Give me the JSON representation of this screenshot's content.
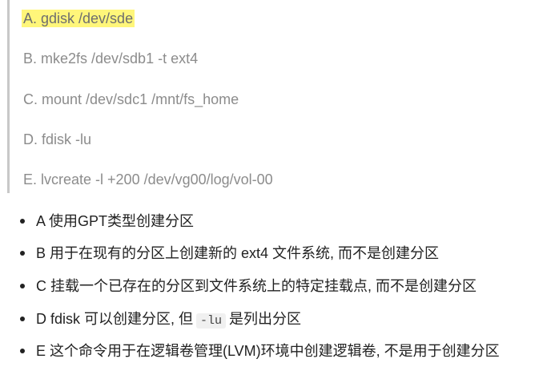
{
  "options": {
    "a": "A. gdisk /dev/sde",
    "b": "B. mke2fs /dev/sdb1 -t ext4",
    "c": "C. mount /dev/sdc1 /mnt/fs_home",
    "d": "D. fdisk -lu",
    "e": "E. lvcreate -l +200 /dev/vg00/log/vol-00"
  },
  "highlight_color": "#fff67a",
  "explanations": {
    "a": "A 使用GPT类型创建分区",
    "b": "B 用于在现有的分区上创建新的 ext4 文件系统, 而不是创建分区",
    "c": "C 挂载一个已存在的分区到文件系统上的特定挂载点, 而不是创建分区",
    "d_before": "D fdisk 可以创建分区, 但",
    "d_code": "-lu",
    "d_after": "是列出分区",
    "e": "E 这个命令用于在逻辑卷管理(LVM)环境中创建逻辑卷, 不是用于创建分区"
  }
}
